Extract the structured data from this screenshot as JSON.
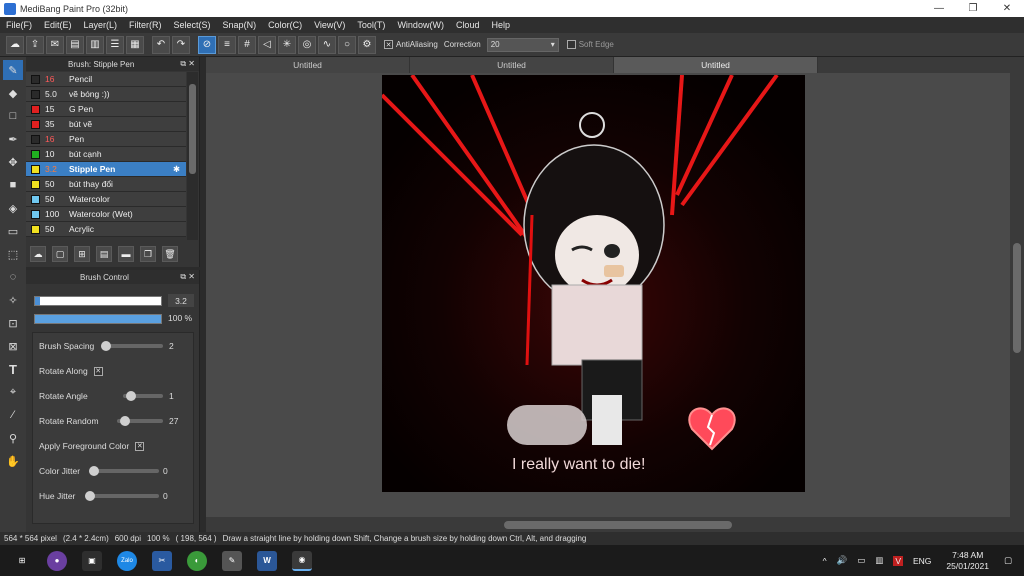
{
  "window": {
    "title": "MediBang Paint Pro (32bit)",
    "minimize": "—",
    "maximize": "❐",
    "close": "✕"
  },
  "menu": [
    "File(F)",
    "Edit(E)",
    "Layer(L)",
    "Filter(R)",
    "Select(S)",
    "Snap(N)",
    "Color(C)",
    "View(V)",
    "Tool(T)",
    "Window(W)",
    "Cloud",
    "Help"
  ],
  "toolbar": {
    "antialiasing_label": "AntiAliasing",
    "antialiasing_checked": "✕",
    "correction_label": "Correction",
    "correction_value": "20",
    "softedge_label": "Soft Edge"
  },
  "brush_panel": {
    "title": "Brush: Stipple Pen",
    "items": [
      {
        "size": "16",
        "name": "Pencil",
        "color": "#2a2a2a",
        "size_color": "#ff5a5a"
      },
      {
        "size": "5.0",
        "name": "vẽ bóng :))",
        "color": "#2a2a2a",
        "size_color": "#eeeeee"
      },
      {
        "size": "15",
        "name": "G Pen",
        "color": "#e02020",
        "size_color": "#eeeeee"
      },
      {
        "size": "35",
        "name": "bút vẽ",
        "color": "#e02020",
        "size_color": "#eeeeee"
      },
      {
        "size": "16",
        "name": "Pen",
        "color": "#2a2a2a",
        "size_color": "#ff5a5a"
      },
      {
        "size": "10",
        "name": "bút cạnh",
        "color": "#20b020",
        "size_color": "#eeeeee"
      },
      {
        "size": "3.2",
        "name": "Stipple Pen",
        "color": "#f0e020",
        "size_color": "#ff7a3a",
        "selected": true
      },
      {
        "size": "50",
        "name": "bút thay đổi",
        "color": "#f0e020",
        "size_color": "#eeeeee"
      },
      {
        "size": "50",
        "name": "Watercolor",
        "color": "#70c8f0",
        "size_color": "#eeeeee"
      },
      {
        "size": "100",
        "name": "Watercolor (Wet)",
        "color": "#70c8f0",
        "size_color": "#eeeeee"
      },
      {
        "size": "50",
        "name": "Acrylic",
        "color": "#f0e020",
        "size_color": "#eeeeee"
      }
    ]
  },
  "brush_control": {
    "title": "Brush Control",
    "size_value": "3.2",
    "size_fraction": 0.04,
    "opacity_value": "100 %",
    "opacity_fraction": 1.0,
    "brush_spacing_label": "Brush Spacing",
    "brush_spacing_value": "2",
    "rotate_along_label": "Rotate Along",
    "rotate_along_checked": "✕",
    "rotate_angle_label": "Rotate Angle",
    "rotate_angle_value": "1",
    "rotate_random_label": "Rotate Random",
    "rotate_random_value": "27",
    "apply_fg_label": "Apply Foreground Color",
    "apply_fg_checked": "✕",
    "color_jitter_label": "Color Jitter",
    "color_jitter_value": "0",
    "hue_jitter_label": "Hue Jitter",
    "hue_jitter_value": "0"
  },
  "tabs": [
    "Untitled",
    "Untitled",
    "Untitled"
  ],
  "canvas": {
    "caption": "I really want to die!"
  },
  "status": {
    "dims": "564 * 564 pixel",
    "physical": "(2.4 * 2.4cm)",
    "dpi": "600 dpi",
    "zoom": "100 %",
    "coords": "( 198, 564 )",
    "hint": "Draw a straight line by holding down Shift, Change a brush size by holding down Ctrl, Alt, and dragging"
  },
  "taskbar": {
    "zalo_label": "Zalo",
    "word_label": "W",
    "lang": "ENG",
    "time": "7:48 AM",
    "date": "25/01/2021"
  },
  "colors": {
    "accent": "#2f6fb5",
    "selection": "#3b7fc4",
    "canvas_bg": "#080000",
    "red": "#ff1a1a"
  }
}
